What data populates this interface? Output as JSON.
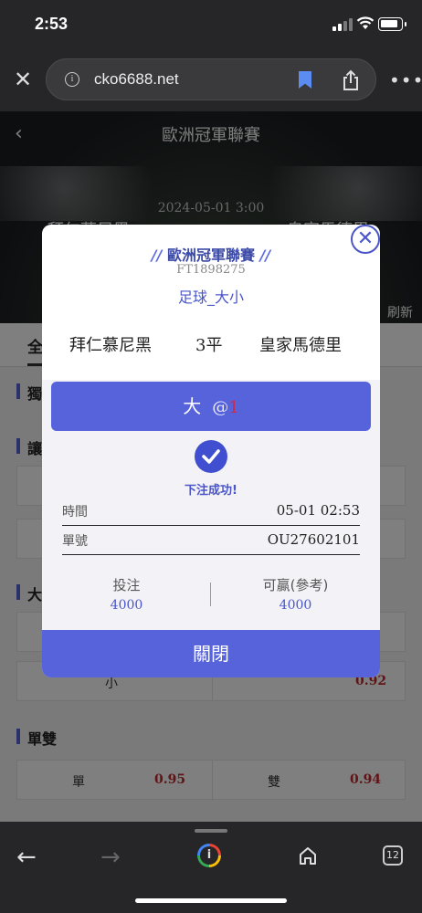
{
  "status_bar": {
    "time": "2:53"
  },
  "browser": {
    "url": "cko6688.net"
  },
  "page": {
    "hero_title": "歐洲冠軍聯賽",
    "hero_date": "2024-05-01 3:00",
    "hero_home": "拜仁慕尼黑",
    "hero_away": "皇家馬德里",
    "refresh": "刷新",
    "tab_all": "全",
    "sections": {
      "solo": "獨",
      "handicap": "讓",
      "overunder": "大",
      "oddeven": "單雙"
    },
    "under_row": {
      "label": "小",
      "value": "0.92"
    },
    "oddeven_row": [
      {
        "label": "單",
        "value": "0.95"
      },
      {
        "label": "雙",
        "value": "0.94"
      }
    ]
  },
  "modal": {
    "league": "歐洲冠軍聯賽",
    "slashes": "//",
    "code": "FT1898275",
    "bet_type": "足球_大小",
    "home": "拜仁慕尼黑",
    "handicap": "3平",
    "away": "皇家馬德里",
    "pick": "大",
    "at": "@",
    "odd": "1",
    "success": "下注成功!",
    "time_label": "時間",
    "time_value": "05-01 02:53",
    "ticket_label": "單號",
    "ticket_value": "OU27602101",
    "stake_label": "投注",
    "stake_value": "4000",
    "win_label": "可贏(參考)",
    "win_value": "4000",
    "close_label": "關閉"
  },
  "toolbar": {
    "tabs_count": "12"
  },
  "colors": {
    "accent": "#5663db",
    "odds_red": "#c0282d",
    "status_bg": "#262628"
  }
}
